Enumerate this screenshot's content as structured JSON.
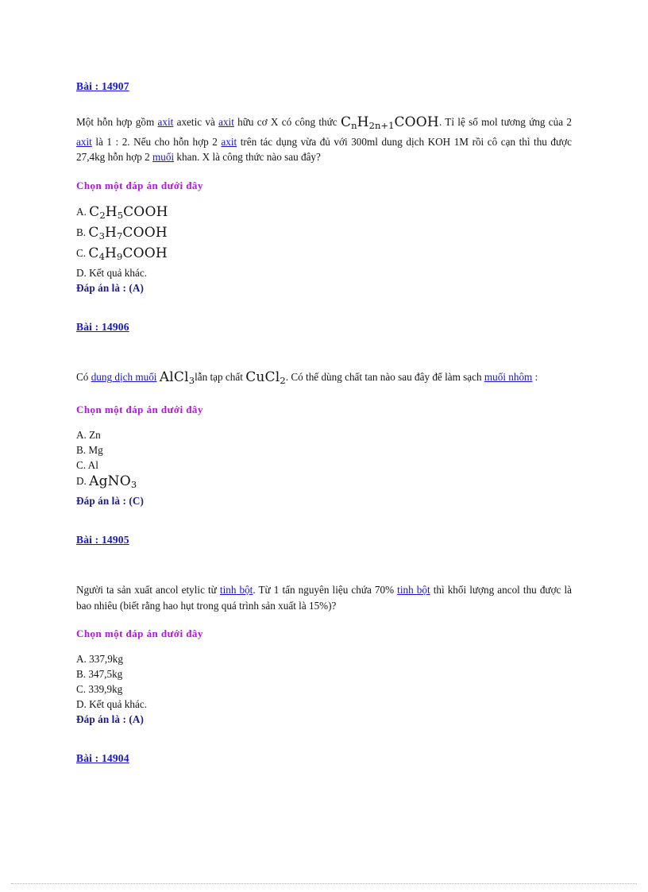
{
  "page": {
    "background_color": "#ffffff",
    "link_color": "#1414d2",
    "prompt_color": "#b414e6",
    "answer_color": "#1a1a8c",
    "text_color": "#141414"
  },
  "questions": [
    {
      "id_label": "Bài : 14907",
      "body": {
        "seg1": "Một hỗn hợp gồm ",
        "link1": "axit",
        "seg2": " axetic và ",
        "link2": "axit",
        "seg3": " hữu cơ X có công thức ",
        "formula": "CnH2n+1COOH",
        "seg4": ". Tỉ lệ số mol tương ứng của 2 ",
        "link3": "axit",
        "seg5": " là 1 : 2. Nếu cho hỗn hợp 2 ",
        "link4": "axit",
        "seg6": " trên tác dụng vừa đủ với 300ml dung dịch KOH 1M rồi cô cạn thì thu được 27,4kg hỗn hợp 2 ",
        "link5": "muối",
        "seg7": " khan. X là công thức nào sau đây?"
      },
      "prompt": "Chọn một đáp án dưới đây",
      "options": [
        {
          "label": "A.",
          "text": "C2H5COOH",
          "is_math": true
        },
        {
          "label": "B.",
          "text": "C3H7COOH",
          "is_math": true
        },
        {
          "label": "C.",
          "text": "C4H9COOH",
          "is_math": true
        },
        {
          "label": "D.",
          "text": "Kết quả khác.",
          "is_math": false
        }
      ],
      "answer": "Đáp án là : (A)"
    },
    {
      "id_label": "Bài : 14906",
      "body": {
        "seg1": "Có ",
        "link1": "dung dịch muối",
        "seg2": " ",
        "formula1": "AlCl3",
        "seg3": "lẫn tạp chất ",
        "formula2": "CuCl2",
        "seg4": ". Có thể dùng chất tan nào sau đây để làm sạch ",
        "link2": "muối nhôm",
        "seg5": " :"
      },
      "prompt": "Chọn một đáp án dưới đây",
      "options": [
        {
          "label": "A.",
          "text": "Zn",
          "is_math": false
        },
        {
          "label": "B.",
          "text": "Mg",
          "is_math": false
        },
        {
          "label": "C.",
          "text": "Al",
          "is_math": false
        },
        {
          "label": "D.",
          "text": "AgNO3",
          "is_math": true
        }
      ],
      "answer": "Đáp án là : (C)"
    },
    {
      "id_label": "Bài : 14905",
      "body": {
        "seg1": "Người ta sản xuất ancol etylic từ ",
        "link1": "tinh bột",
        "seg2": ". Từ 1 tấn nguyên liệu chứa 70% ",
        "link2": "tinh bột",
        "seg3": " thì khối lượng ancol thu được là bao nhiêu (biết rằng hao hụt trong quá trình sản xuất là 15%)?"
      },
      "prompt": "Chọn một đáp án dưới đây",
      "options": [
        {
          "label": "A.",
          "text": "337,9kg",
          "is_math": false
        },
        {
          "label": "B.",
          "text": "347,5kg",
          "is_math": false
        },
        {
          "label": "C.",
          "text": "339,9kg",
          "is_math": false
        },
        {
          "label": "D.",
          "text": "Kết quả khác.",
          "is_math": false
        }
      ],
      "answer": "Đáp án là : (A)"
    }
  ],
  "trailing_link": "Bài : 14904"
}
